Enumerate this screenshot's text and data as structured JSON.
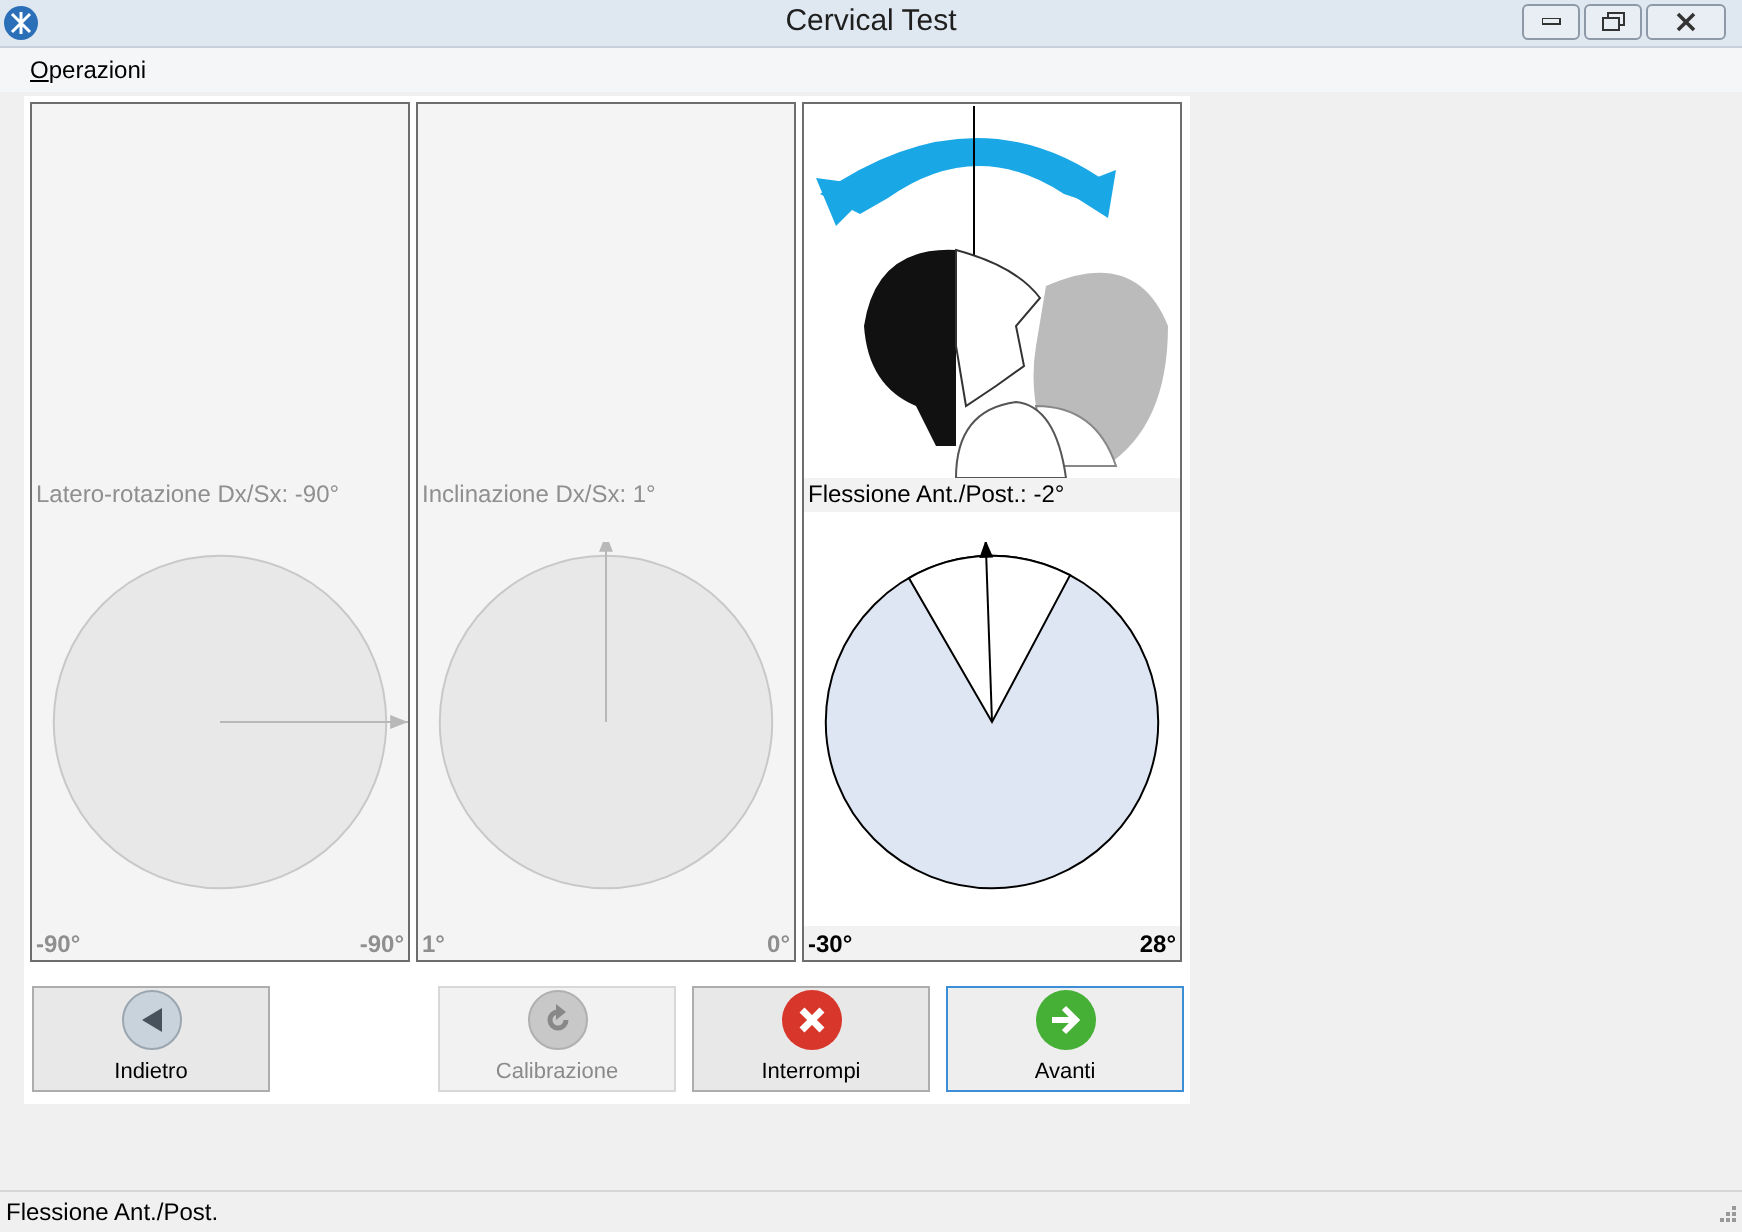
{
  "window": {
    "title": "Cervical Test"
  },
  "menu": [
    {
      "accelerator": "O",
      "label_rest": "perazioni"
    }
  ],
  "panels": [
    {
      "label": "Latero-rotazione Dx/Sx: -90°",
      "disabled": true,
      "kind": "horizontal",
      "min": "-90°",
      "max": "-90°",
      "illustration": false
    },
    {
      "label": "Inclinazione Dx/Sx: 1°",
      "disabled": true,
      "kind": "vertical",
      "min": "1°",
      "max": "0°",
      "illustration": false
    },
    {
      "label": "Flessione Ant./Post.: -2°",
      "disabled": false,
      "kind": "vertical",
      "min": "-30°",
      "max": "28°",
      "illustration": true
    }
  ],
  "buttons": [
    {
      "label": "Indietro",
      "kind": "back",
      "disabled": false,
      "focused": false
    },
    {
      "label": "Calibrazione",
      "kind": "calibrate",
      "disabled": true,
      "focused": false
    },
    {
      "label": "Interrompi",
      "kind": "stop",
      "disabled": false,
      "focused": false
    },
    {
      "label": "Avanti",
      "kind": "next",
      "disabled": false,
      "focused": true
    }
  ],
  "status_bar": "Flessione Ant./Post."
}
